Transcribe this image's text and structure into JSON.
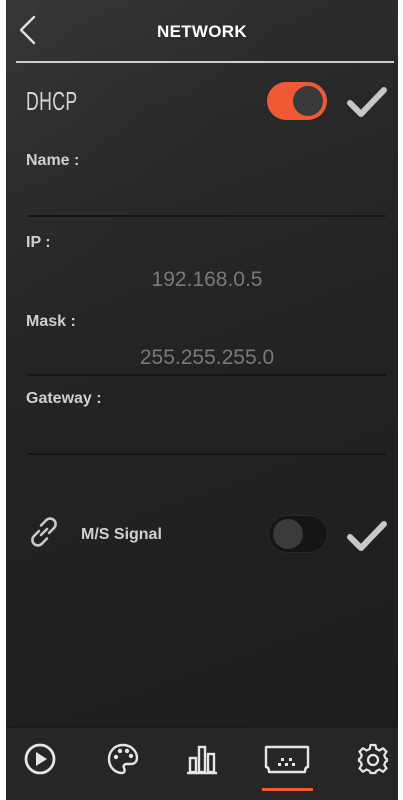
{
  "header": {
    "title": "NETWORK"
  },
  "dhcp": {
    "label": "DHCP",
    "enabled": true
  },
  "fields": {
    "name": {
      "label": "Name :",
      "value": ""
    },
    "ip": {
      "label": "IP :",
      "value": "192.168.0.5"
    },
    "mask": {
      "label": "Mask :",
      "value": "255.255.255.0"
    },
    "gateway": {
      "label": "Gateway :",
      "value": ""
    }
  },
  "ms_signal": {
    "label": "M/S Signal",
    "enabled": false
  },
  "nav": {
    "items": [
      {
        "icon": "play-icon",
        "active": false
      },
      {
        "icon": "palette-icon",
        "active": false
      },
      {
        "icon": "bar-chart-icon",
        "active": false
      },
      {
        "icon": "display-icon",
        "active": true
      },
      {
        "icon": "gear-icon",
        "active": false
      }
    ]
  },
  "colors": {
    "accent": "#ef5a34",
    "background": "#262626",
    "label": "#d0d0d0",
    "value": "#7a7a7a"
  }
}
